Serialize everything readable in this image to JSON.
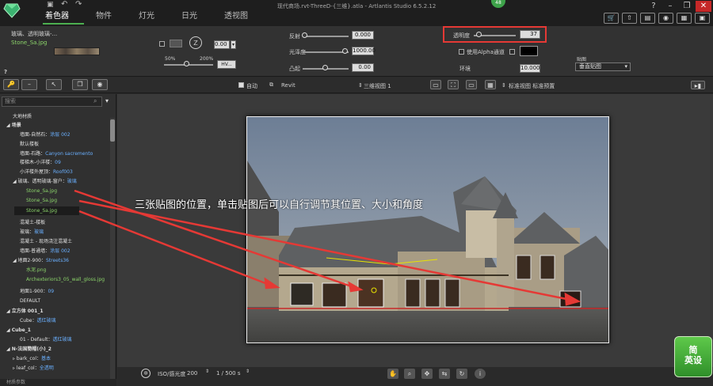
{
  "app": {
    "window_title": "现代商场.rvt-ThreeD-{三维}.atla - Artlantis Studio 6.5.2.12",
    "badge": "48",
    "tabs": [
      "着色器",
      "物件",
      "灯光",
      "日光",
      "透视图"
    ],
    "active_tab": "着色器"
  },
  "colors": {
    "accent": "#4caf50",
    "highlight": "#e53935",
    "link": "#6ab0ff"
  },
  "props": {
    "material_path": "玻璃、透明玻璃-...",
    "texture_name": "Stone_Sa.jpg",
    "rotation_value": "0.00",
    "scale_min": "50%",
    "scale_max": "200%",
    "hv_button": "HV...",
    "reflection_label": "反射",
    "reflection_value": "0.000",
    "gloss_label": "光泽度",
    "gloss_value": "1000.00",
    "bump_label": "凸起",
    "bump_value": "0.00",
    "transparency_label": "透明度",
    "transparency_value": "37",
    "alpha_label": "使用Alpha通道",
    "env_label": "环境",
    "env_value": "10.000",
    "mapping_label": "贴图",
    "mapping_value": "垂直贴图",
    "question": "?"
  },
  "toolbar2": {
    "auto_label": "自动",
    "revit_label": "Revit",
    "view_label": "三维视图 1",
    "preset_label": "标准视图 标准预置"
  },
  "tree": {
    "search_placeholder": "搜索",
    "items": [
      {
        "text": "大地材质",
        "value": ""
      },
      {
        "text": "场景",
        "value": ""
      },
      {
        "text": "墙面-自然石：",
        "value": "涂层 002"
      },
      {
        "text": "默认楼板",
        "value": ""
      },
      {
        "text": "墙面-石路：",
        "value": "Canyon sacremento"
      },
      {
        "text": "楼梯木-小洋楼：",
        "value": "09"
      },
      {
        "text": "小洋楼外屋顶：",
        "value": "Roof003"
      },
      {
        "text": "玻璃、透明玻璃-窗户：",
        "value": "玻璃"
      },
      {
        "text": "Stone_Sa.jpg",
        "value": ""
      },
      {
        "text": "Stone_Sa.jpg",
        "value": ""
      },
      {
        "text": "Stone_Sa.jpg",
        "value": ""
      },
      {
        "text": "混凝土-楼板",
        "value": ""
      },
      {
        "text": "玻璃：",
        "value": "玻璃"
      },
      {
        "text": "混凝土 - 现场浇注混凝土",
        "value": ""
      },
      {
        "text": "墙面-普通墙：",
        "value": "涂层 002"
      },
      {
        "text": "地面2-900：",
        "value": "Streets36"
      },
      {
        "text": "水泥.png",
        "value": ""
      },
      {
        "text": "Archexteriors3_05_wall_gloss.jpg",
        "value": ""
      },
      {
        "text": "地面1-900：",
        "value": "09"
      },
      {
        "text": "DEFAULT",
        "value": ""
      },
      {
        "text": "立方体 001_1",
        "value": ""
      },
      {
        "text": "Cube：",
        "value": "透红玻璃"
      },
      {
        "text": "Cube_1",
        "value": ""
      },
      {
        "text": "01 - Default：",
        "value": "透红玻璃"
      },
      {
        "text": "N-法国簡帽(小)_2",
        "value": ""
      },
      {
        "text": "bark_col：",
        "value": "基本"
      },
      {
        "text": "leaf_col：",
        "value": "全透明"
      }
    ],
    "footer": "材质参数"
  },
  "bottom": {
    "iso_label": "ISO/感光度",
    "iso_value": "200",
    "shutter_value": "1 / 500 s"
  },
  "annotation": "三张贴图的位置，单击贴图后可以自行调节其位置、大小和角度",
  "watermark": "简\n英设"
}
